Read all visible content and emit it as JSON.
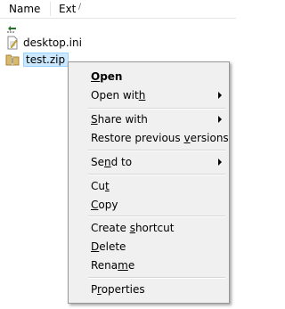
{
  "columns": {
    "name": "Name",
    "ext": "Ext"
  },
  "files": [
    {
      "name": "desktop.ini",
      "icon": "ini-file-icon"
    },
    {
      "name": "test.zip",
      "icon": "zip-folder-icon"
    }
  ],
  "menu": {
    "open": {
      "pre": "",
      "key": "O",
      "post": "pen"
    },
    "open_with": {
      "pre": "Open wit",
      "key": "h",
      "post": ""
    },
    "share_with": {
      "pre": "",
      "key": "S",
      "post": "hare with"
    },
    "restore": {
      "pre": "Restore previous ",
      "key": "v",
      "post": "ersions"
    },
    "send_to": {
      "pre": "Se",
      "key": "n",
      "post": "d to"
    },
    "cut": {
      "pre": "Cu",
      "key": "t",
      "post": ""
    },
    "copy": {
      "pre": "",
      "key": "C",
      "post": "opy"
    },
    "create_shortcut": {
      "pre": "Create ",
      "key": "s",
      "post": "hortcut"
    },
    "delete": {
      "pre": "",
      "key": "D",
      "post": "elete"
    },
    "rename": {
      "pre": "Rena",
      "key": "m",
      "post": "e"
    },
    "properties": {
      "pre": "P",
      "key": "r",
      "post": "operties"
    }
  },
  "colors": {
    "selection": "#cce8ff",
    "menu_bg": "#f0f0f0"
  }
}
